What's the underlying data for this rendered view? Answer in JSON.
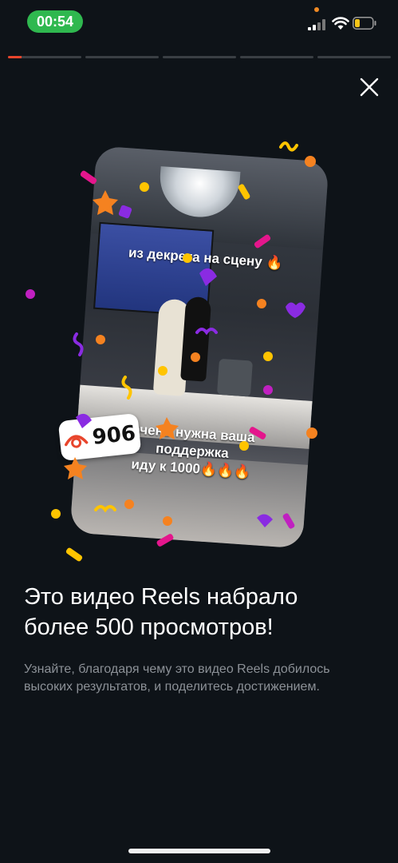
{
  "status_bar": {
    "time": "00:54",
    "time_pill_color": "#2fb84f",
    "recording_dot_color": "#f08a24",
    "icons": [
      "signal-icon",
      "wifi-icon",
      "battery-icon"
    ]
  },
  "progress": {
    "segments": 5,
    "active_index": 0,
    "active_fill": 0.18,
    "accent": "#e8452c"
  },
  "header": {
    "close_icon": "close-icon"
  },
  "card": {
    "caption_top": "из декрета на сцену 🔥",
    "caption_bottom_line1": "очень нужна ваша",
    "caption_bottom_line2": "поддержка",
    "caption_bottom_line3": "иду к 1000🔥🔥🔥",
    "views_icon": "eye-icon",
    "views_count": "906"
  },
  "content": {
    "headline_line1": "Это видео Reels набрало",
    "headline_line2": "более 500 просмотров!",
    "description": "Узнайте, благодаря чему это видео Reels добилось высоких результатов, и поделитесь достижением."
  },
  "colors": {
    "background": "#0e1318",
    "confetti": [
      "#f58220",
      "#ffc400",
      "#8a2be2",
      "#e4168c",
      "#c020c0"
    ]
  }
}
